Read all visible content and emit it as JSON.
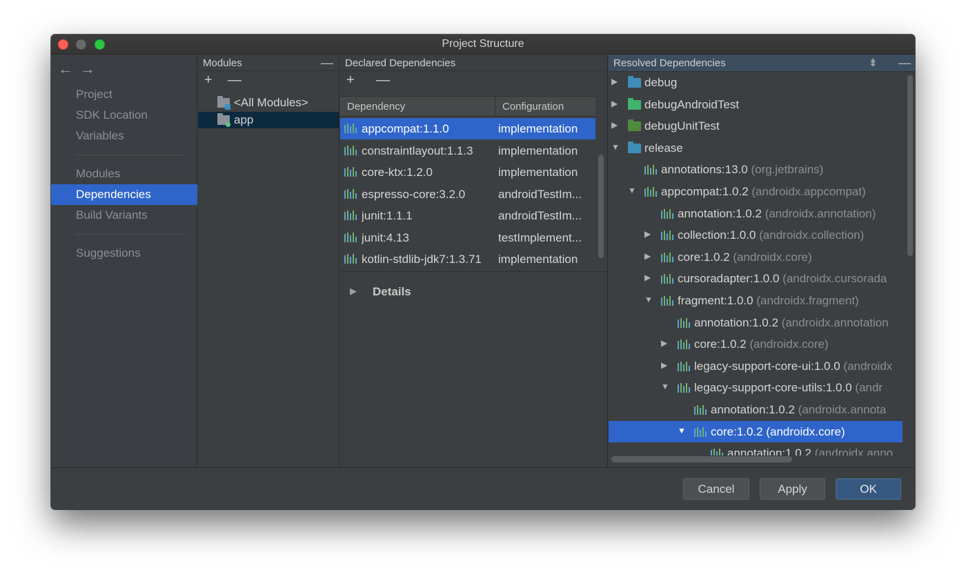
{
  "window": {
    "title": "Project Structure"
  },
  "nav": {
    "back_icon": "←",
    "forward_icon": "→",
    "items": [
      {
        "label": "Project"
      },
      {
        "label": "SDK Location"
      },
      {
        "label": "Variables"
      },
      {
        "label": "Modules"
      },
      {
        "label": "Dependencies",
        "selected": true
      },
      {
        "label": "Build Variants"
      },
      {
        "label": "Suggestions"
      }
    ]
  },
  "modules": {
    "header": "Modules",
    "minimize": "—",
    "add": "+",
    "remove": "—",
    "items": [
      {
        "label": "<All Modules>"
      },
      {
        "label": "app",
        "selected": true
      }
    ]
  },
  "declared": {
    "header": "Declared Dependencies",
    "add": "+",
    "remove": "—",
    "columns": [
      "Dependency",
      "Configuration"
    ],
    "rows": [
      {
        "dependency": "appcompat:1.1.0",
        "configuration": "implementation",
        "selected": true
      },
      {
        "dependency": "constraintlayout:1.1.3",
        "configuration": "implementation"
      },
      {
        "dependency": "core-ktx:1.2.0",
        "configuration": "implementation"
      },
      {
        "dependency": "espresso-core:3.2.0",
        "configuration": "androidTestIm..."
      },
      {
        "dependency": "junit:1.1.1",
        "configuration": "androidTestIm..."
      },
      {
        "dependency": "junit:4.13",
        "configuration": "testImplement..."
      },
      {
        "dependency": "kotlin-stdlib-jdk7:1.3.71",
        "configuration": "implementation"
      }
    ],
    "details_label": "Details",
    "details_arrow": "▶"
  },
  "resolved": {
    "header": "Resolved Dependencies",
    "collapse_icon": "⇟",
    "minimize": "—",
    "nodes": [
      {
        "arrow": "▶",
        "kind": "folder",
        "folder_color": "#3e8eb8",
        "name": "debug",
        "group": ""
      },
      {
        "arrow": "▶",
        "kind": "folder",
        "folder_color": "#3fb36a",
        "name": "debugAndroidTest",
        "group": ""
      },
      {
        "arrow": "▶",
        "kind": "folder",
        "folder_color": "#4f8a3f",
        "name": "debugUnitTest",
        "group": ""
      },
      {
        "arrow": "▼",
        "kind": "folder",
        "folder_color": "#3e8eb8",
        "name": "release",
        "group": ""
      },
      {
        "arrow": "",
        "kind": "lib",
        "name": "annotations:13.0",
        "group": "(org.jetbrains)"
      },
      {
        "arrow": "▼",
        "kind": "lib",
        "name": "appcompat:1.0.2",
        "group": "(androidx.appcompat)"
      },
      {
        "arrow": "",
        "kind": "lib",
        "name": "annotation:1.0.2",
        "group": "(androidx.annotation)"
      },
      {
        "arrow": "▶",
        "kind": "lib",
        "name": "collection:1.0.0",
        "group": "(androidx.collection)"
      },
      {
        "arrow": "▶",
        "kind": "lib",
        "name": "core:1.0.2",
        "group": "(androidx.core)"
      },
      {
        "arrow": "▶",
        "kind": "lib",
        "name": "cursoradapter:1.0.0",
        "group": "(androidx.cursorada"
      },
      {
        "arrow": "▼",
        "kind": "lib",
        "name": "fragment:1.0.0",
        "group": "(androidx.fragment)"
      },
      {
        "arrow": "",
        "kind": "lib",
        "name": "annotation:1.0.2",
        "group": "(androidx.annotation"
      },
      {
        "arrow": "▶",
        "kind": "lib",
        "name": "core:1.0.2",
        "group": "(androidx.core)"
      },
      {
        "arrow": "▶",
        "kind": "lib",
        "name": "legacy-support-core-ui:1.0.0",
        "group": "(androidx"
      },
      {
        "arrow": "▼",
        "kind": "lib",
        "name": "legacy-support-core-utils:1.0.0",
        "group": "(andr"
      },
      {
        "arrow": "",
        "kind": "lib",
        "name": "annotation:1.0.2",
        "group": "(androidx.annota"
      },
      {
        "arrow": "▼",
        "kind": "lib",
        "name": "core:1.0.2",
        "group": "(androidx.core)",
        "selected": true
      },
      {
        "arrow": "",
        "kind": "lib",
        "name": "annotation:1.0.2",
        "group": "(androidx.anno"
      }
    ]
  },
  "footer": {
    "cancel": "Cancel",
    "apply": "Apply",
    "ok": "OK"
  }
}
